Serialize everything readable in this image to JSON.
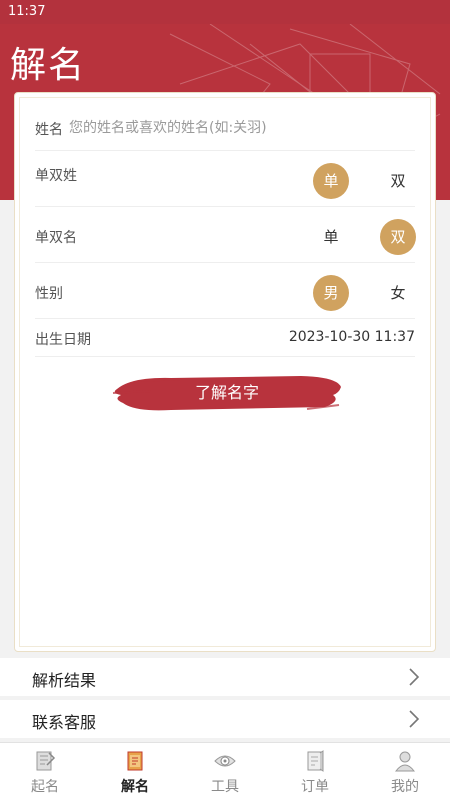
{
  "status_bar": {
    "time": "11:37"
  },
  "header": {
    "title": "解名"
  },
  "form": {
    "name_label": "姓名",
    "name_placeholder": "您的姓名或喜欢的姓名(如:关羽)",
    "surname_type": {
      "label": "单双姓",
      "options": [
        "单",
        "双"
      ],
      "selected": "单"
    },
    "given_type": {
      "label": "单双名",
      "options": [
        "单",
        "双"
      ],
      "selected": "双"
    },
    "gender": {
      "label": "性别",
      "options": [
        "男",
        "女"
      ],
      "selected": "男"
    },
    "birth": {
      "label": "出生日期",
      "value": "2023-10-30 11:37"
    },
    "submit_label": "了解名字"
  },
  "menu": [
    {
      "label": "解析结果"
    },
    {
      "label": "联系客服"
    }
  ],
  "tabs": [
    {
      "label": "起名",
      "icon": "naming-book-icon"
    },
    {
      "label": "解名",
      "icon": "analysis-scroll-icon",
      "active": true
    },
    {
      "label": "工具",
      "icon": "compass-tool-icon"
    },
    {
      "label": "订单",
      "icon": "order-paper-icon"
    },
    {
      "label": "我的",
      "icon": "profile-icon"
    }
  ],
  "colors": {
    "brand_red": "#b8333d",
    "accent_gold": "#d0a25f"
  }
}
